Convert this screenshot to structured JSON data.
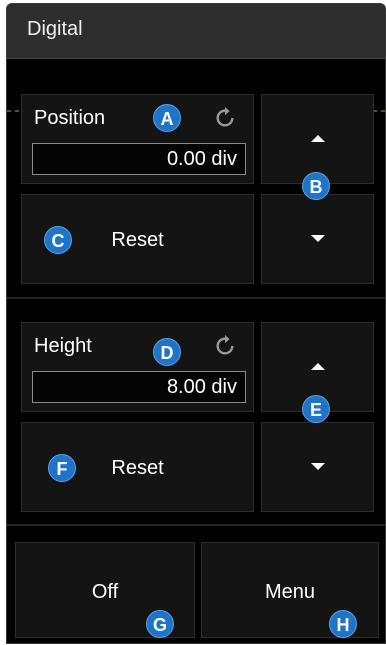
{
  "title": "Digital",
  "position": {
    "label": "Position",
    "value": "0.00 div",
    "reset_label": "Reset"
  },
  "height": {
    "label": "Height",
    "value": "8.00 div",
    "reset_label": "Reset"
  },
  "footer": {
    "off_label": "Off",
    "menu_label": "Menu"
  },
  "callouts": {
    "a": "A",
    "b": "B",
    "c": "C",
    "d": "D",
    "e": "E",
    "f": "F",
    "g": "G",
    "h": "H"
  },
  "colors": {
    "callout_badge": "#1e74c7",
    "panel_bg": "#000000",
    "title_bg": "#2e2e2e"
  }
}
